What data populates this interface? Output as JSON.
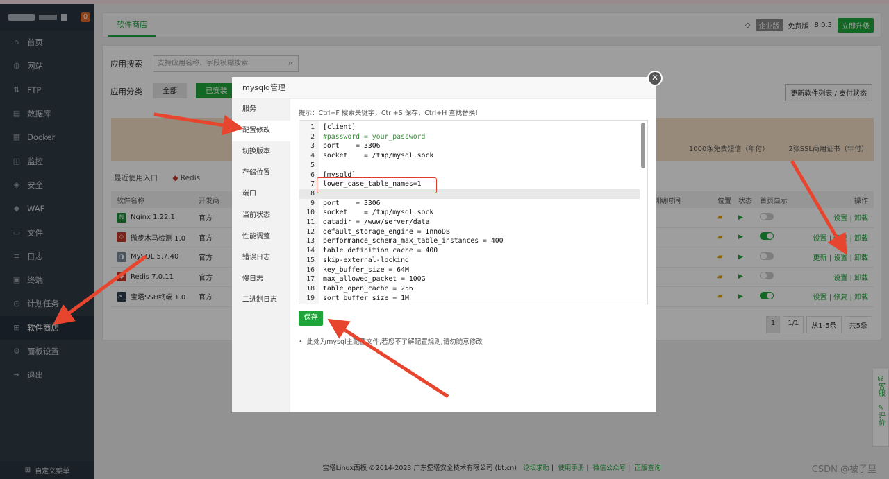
{
  "sidebar": {
    "badge": "0",
    "items": [
      {
        "label": "首页",
        "icon": "home-icon",
        "glyph": "⌂"
      },
      {
        "label": "网站",
        "icon": "globe-icon",
        "glyph": "◍"
      },
      {
        "label": "FTP",
        "icon": "ftp-icon",
        "glyph": "⇅"
      },
      {
        "label": "数据库",
        "icon": "database-icon",
        "glyph": "▤"
      },
      {
        "label": "Docker",
        "icon": "docker-icon",
        "glyph": "▦"
      },
      {
        "label": "监控",
        "icon": "monitor-icon",
        "glyph": "◫"
      },
      {
        "label": "安全",
        "icon": "shield-icon",
        "glyph": "◈"
      },
      {
        "label": "WAF",
        "icon": "waf-icon",
        "glyph": "◆"
      },
      {
        "label": "文件",
        "icon": "file-icon",
        "glyph": "▭"
      },
      {
        "label": "日志",
        "icon": "log-icon",
        "glyph": "≡"
      },
      {
        "label": "终端",
        "icon": "terminal-icon",
        "glyph": "▣"
      },
      {
        "label": "计划任务",
        "icon": "clock-icon",
        "glyph": "◷"
      },
      {
        "label": "软件商店",
        "icon": "grid-icon",
        "glyph": "⊞"
      },
      {
        "label": "面板设置",
        "icon": "gear-icon",
        "glyph": "⚙"
      },
      {
        "label": "退出",
        "icon": "logout-icon",
        "glyph": "⇥"
      }
    ],
    "footer": "自定义菜单"
  },
  "header": {
    "tab": "软件商店",
    "edition": "企业版",
    "free": "免费版",
    "version": "8.0.3",
    "upgrade": "立即升级"
  },
  "store": {
    "search_label": "应用搜索",
    "search_placeholder": "支持应用名称、字段模糊搜索",
    "category_label": "应用分类",
    "cat_all": "全部",
    "cat_installed": "已安装",
    "update_btn": "更新软件列表 / 支付状态",
    "promo_sms": "1000条免费短信（年付）",
    "promo_ssl": "2张SSL商用证书（年付）",
    "recent_label": "最近使用入口",
    "recent_item": "Redis",
    "columns": {
      "name": "软件名称",
      "dev": "开发商",
      "expire": "到期时间",
      "pos": "位置",
      "status": "状态",
      "show": "首页显示",
      "ops": "操作"
    },
    "rows": [
      {
        "name": "Nginx 1.22.1",
        "dev": "官方",
        "ops": "设置 | 卸载",
        "on": false
      },
      {
        "name": "微步木马检测 1.0",
        "dev": "官方",
        "ops": "设置 | 修复 | 卸载",
        "on": true
      },
      {
        "name": "MySQL 5.7.40",
        "dev": "官方",
        "ops": "更新 | 设置 | 卸载",
        "on": false
      },
      {
        "name": "Redis 7.0.11",
        "dev": "官方",
        "ops": "设置 | 卸载",
        "on": false
      },
      {
        "name": "宝塔SSH终端 1.0",
        "dev": "官方",
        "ops": "设置 | 修复 | 卸载",
        "on": true
      }
    ],
    "pager": {
      "page": "1",
      "of": "1/1",
      "range": "从1-5条",
      "total": "共5条"
    }
  },
  "footer": {
    "copyright": "宝塔Linux面板 ©2014-2023 广东堡塔安全技术有限公司 (bt.cn)",
    "links": [
      "论坛求助",
      "使用手册",
      "微信公众号",
      "正版查询"
    ]
  },
  "watermark": "CSDN @被子里",
  "side_float": {
    "service": "客服",
    "review": "评价"
  },
  "modal": {
    "title": "mysqld管理",
    "nav": [
      "服务",
      "配置修改",
      "切换版本",
      "存储位置",
      "端口",
      "当前状态",
      "性能调整",
      "错误日志",
      "慢日志",
      "二进制日志"
    ],
    "tip": "提示：Ctrl+F 搜索关键字，Ctrl+S 保存，Ctrl+H 查找替换!",
    "code": [
      {
        "n": "1",
        "t": "[client]"
      },
      {
        "n": "2",
        "t": "#password = your_password"
      },
      {
        "n": "3",
        "t": "port    = 3306"
      },
      {
        "n": "4",
        "t": "socket    = /tmp/mysql.sock"
      },
      {
        "n": "5",
        "t": ""
      },
      {
        "n": "6",
        "t": "[mysqld]"
      },
      {
        "n": "7",
        "t": "lower_case_table_names=1"
      },
      {
        "n": "8",
        "t": ""
      },
      {
        "n": "9",
        "t": "port    = 3306"
      },
      {
        "n": "10",
        "t": "socket    = /tmp/mysql.sock"
      },
      {
        "n": "11",
        "t": "datadir = /www/server/data"
      },
      {
        "n": "12",
        "t": "default_storage_engine = InnoDB"
      },
      {
        "n": "13",
        "t": "performance_schema_max_table_instances = 400"
      },
      {
        "n": "14",
        "t": "table_definition_cache = 400"
      },
      {
        "n": "15",
        "t": "skip-external-locking"
      },
      {
        "n": "16",
        "t": "key_buffer_size = 64M"
      },
      {
        "n": "17",
        "t": "max_allowed_packet = 100G"
      },
      {
        "n": "18",
        "t": "table_open_cache = 256"
      },
      {
        "n": "19",
        "t": "sort_buffer_size = 1M"
      }
    ],
    "save": "保存",
    "note": "此处为mysql主配置文件,若您不了解配置规则,请勿随意修改"
  }
}
